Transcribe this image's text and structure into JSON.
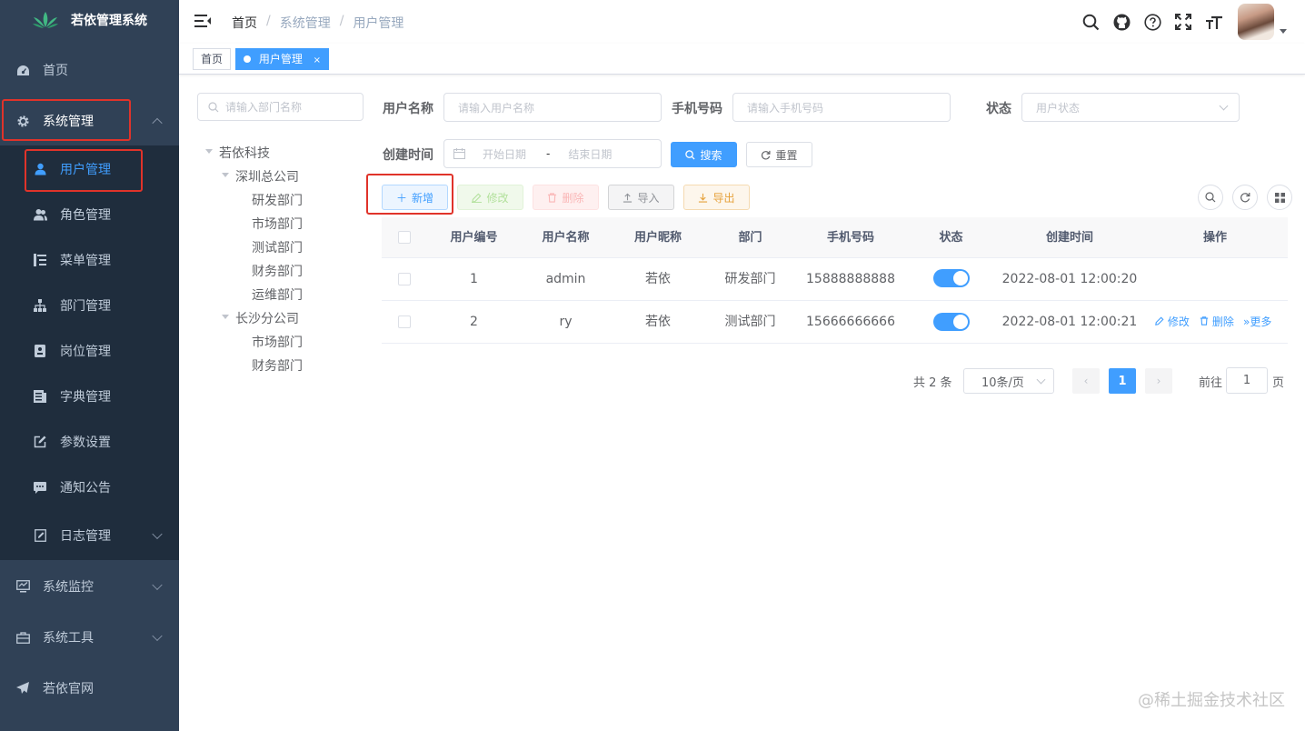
{
  "app": {
    "title": "若依管理系统"
  },
  "sidebar": {
    "items": [
      {
        "label": "首页",
        "icon": "dashboard-icon"
      },
      {
        "label": "系统管理",
        "icon": "gear-icon",
        "expanded": true
      },
      {
        "label": "系统监控",
        "icon": "monitor-icon"
      },
      {
        "label": "系统工具",
        "icon": "toolbox-icon"
      },
      {
        "label": "若依官网",
        "icon": "paper-plane-icon"
      }
    ],
    "sub_items": [
      {
        "label": "用户管理",
        "icon": "user-icon",
        "active": true
      },
      {
        "label": "角色管理",
        "icon": "peoples-icon"
      },
      {
        "label": "菜单管理",
        "icon": "tree-table-icon"
      },
      {
        "label": "部门管理",
        "icon": "tree-icon"
      },
      {
        "label": "岗位管理",
        "icon": "post-icon"
      },
      {
        "label": "字典管理",
        "icon": "dict-icon"
      },
      {
        "label": "参数设置",
        "icon": "edit-icon"
      },
      {
        "label": "通知公告",
        "icon": "message-icon"
      },
      {
        "label": "日志管理",
        "icon": "log-icon"
      }
    ]
  },
  "navbar": {
    "breadcrumb": [
      "首页",
      "系统管理",
      "用户管理"
    ],
    "icons": [
      "search-icon",
      "github-icon",
      "question-icon",
      "fullscreen-icon",
      "text-size-icon"
    ]
  },
  "tags": [
    {
      "label": "首页",
      "active": false
    },
    {
      "label": "用户管理",
      "active": true,
      "close": "×"
    }
  ],
  "dept_tree": {
    "search_placeholder": "请输入部门名称",
    "nodes": [
      "若依科技",
      "深圳总公司",
      "研发部门",
      "市场部门",
      "测试部门",
      "财务部门",
      "运维部门",
      "长沙分公司",
      "市场部门",
      "财务部门"
    ]
  },
  "search_form": {
    "username_label": "用户名称",
    "username_placeholder": "请输入用户名称",
    "phone_label": "手机号码",
    "phone_placeholder": "请输入手机号码",
    "status_label": "状态",
    "status_placeholder": "用户状态",
    "created_label": "创建时间",
    "start_placeholder": "开始日期",
    "range_sep": "-",
    "end_placeholder": "结束日期",
    "search_btn": "搜索",
    "reset_btn": "重置"
  },
  "toolbar": {
    "add": "新增",
    "edit": "修改",
    "delete": "删除",
    "import": "导入",
    "export": "导出"
  },
  "table": {
    "columns": [
      "用户编号",
      "用户名称",
      "用户昵称",
      "部门",
      "手机号码",
      "状态",
      "创建时间",
      "操作"
    ],
    "rows": [
      {
        "id": "1",
        "username": "admin",
        "nickname": "若依",
        "dept": "研发部门",
        "phone": "15888888888",
        "status": true,
        "created": "2022-08-01 12:00:20",
        "ops": []
      },
      {
        "id": "2",
        "username": "ry",
        "nickname": "若依",
        "dept": "测试部门",
        "phone": "15666666666",
        "status": true,
        "created": "2022-08-01 12:00:21",
        "ops": [
          "修改",
          "删除",
          "更多"
        ]
      }
    ]
  },
  "pagination": {
    "total_text": "共 2 条",
    "page_size": "10条/页",
    "current_page": "1",
    "goto_label": "前往",
    "goto_value": "1",
    "page_suffix": "页"
  },
  "watermark": "@稀土掘金技术社区",
  "colors": {
    "sidebar": "#304156",
    "submenu": "#1f2d3d",
    "primary": "#409eff",
    "highlight": "#e0332a"
  }
}
